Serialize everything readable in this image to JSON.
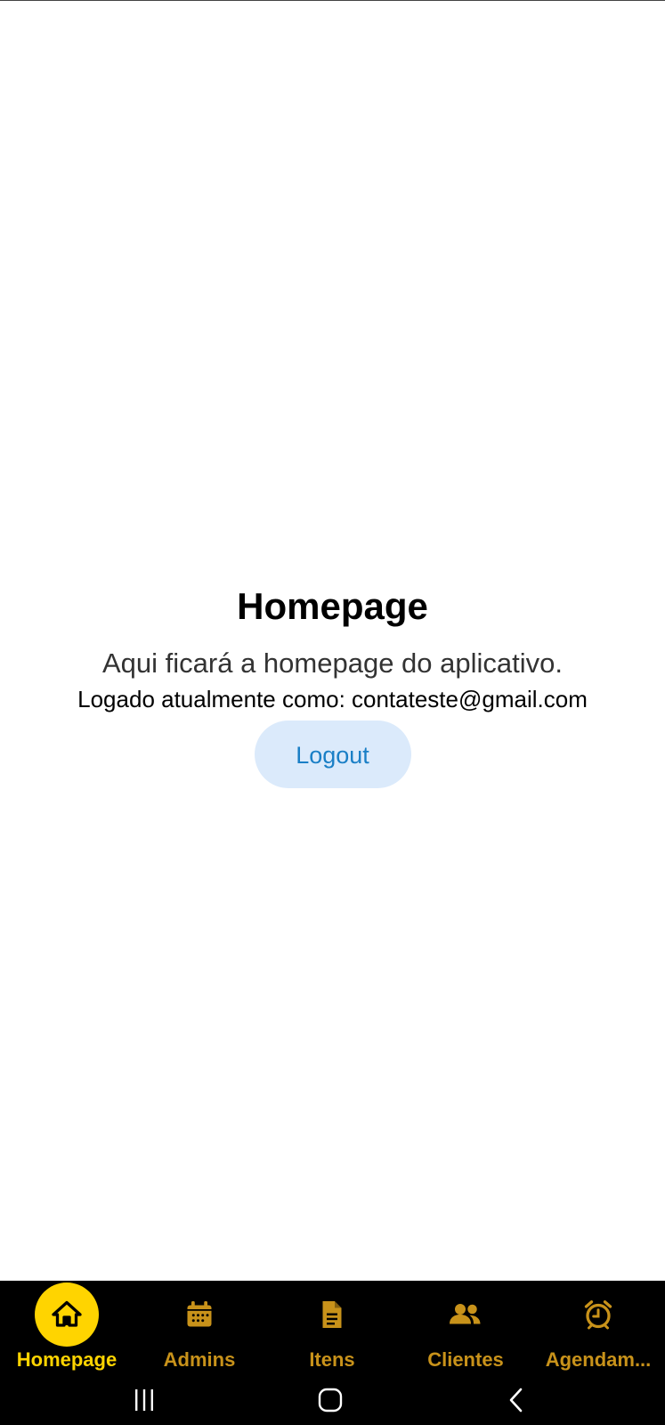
{
  "main": {
    "title": "Homepage",
    "subtitle": "Aqui ficará a homepage do aplicativo.",
    "logged_in_text": "Logado atualmente como: contateste@gmail.com",
    "logout_label": "Logout"
  },
  "bottom_nav": {
    "active_index": 0,
    "items": [
      {
        "label": "Homepage",
        "icon": "home-icon"
      },
      {
        "label": "Admins",
        "icon": "calendar-icon"
      },
      {
        "label": "Itens",
        "icon": "document-icon"
      },
      {
        "label": "Clientes",
        "icon": "people-icon"
      },
      {
        "label": "Agendam...",
        "icon": "alarm-clock-icon"
      }
    ]
  },
  "system_nav": {
    "buttons": [
      "recent-apps-icon",
      "home-button-icon",
      "back-icon"
    ]
  },
  "colors": {
    "accent": "#ffd400",
    "nav_inactive": "#c8921a",
    "nav_background": "#000000",
    "logout_bg": "#dbeafb",
    "logout_text": "#1a7fc6"
  }
}
